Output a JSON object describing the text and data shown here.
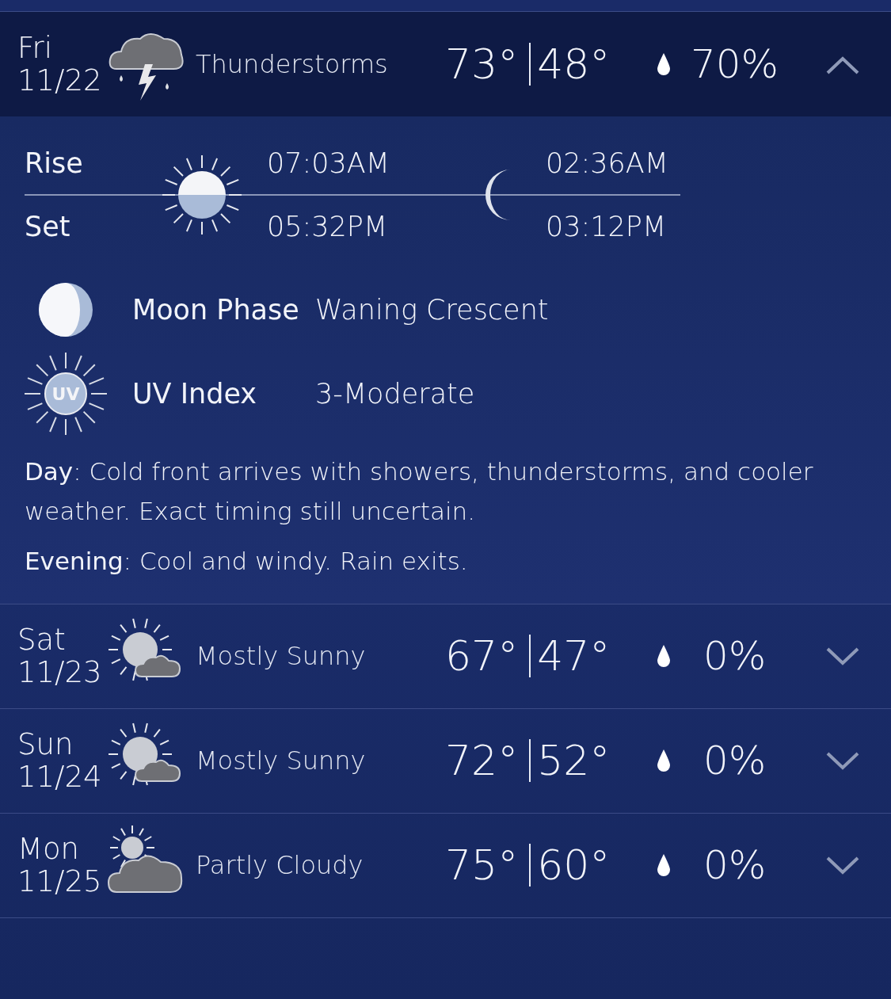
{
  "days": [
    {
      "day": "Fri",
      "date": "11/22",
      "kind": "thunderstorm",
      "condition": "Thunderstorms",
      "high": "73°",
      "low": "48°",
      "precip": "70%",
      "expanded": true,
      "details": {
        "rise_label": "Rise",
        "set_label": "Set",
        "sunrise": "07:03AM",
        "sunset": "05:32PM",
        "moonrise": "02:36AM",
        "moonset": "03:12PM",
        "moon_phase_label": "Moon Phase",
        "moon_phase": "Waning Crescent",
        "uv_icon_text": "UV",
        "uv_label": "UV Index",
        "uv_value": "3-Moderate",
        "day_label": "Day",
        "day_text": ": Cold front arrives with showers, thunderstorms, and cooler weather. Exact timing still uncertain.",
        "evening_label": "Evening",
        "evening_text": ": Cool and windy. Rain exits."
      }
    },
    {
      "day": "Sat",
      "date": "11/23",
      "kind": "mostly_sunny",
      "condition": "Mostly Sunny",
      "high": "67°",
      "low": "47°",
      "precip": "0%",
      "expanded": false
    },
    {
      "day": "Sun",
      "date": "11/24",
      "kind": "mostly_sunny",
      "condition": "Mostly Sunny",
      "high": "72°",
      "low": "52°",
      "precip": "0%",
      "expanded": false
    },
    {
      "day": "Mon",
      "date": "11/25",
      "kind": "partly_cloudy",
      "condition": "Partly Cloudy",
      "high": "75°",
      "low": "60°",
      "precip": "0%",
      "expanded": false
    }
  ]
}
